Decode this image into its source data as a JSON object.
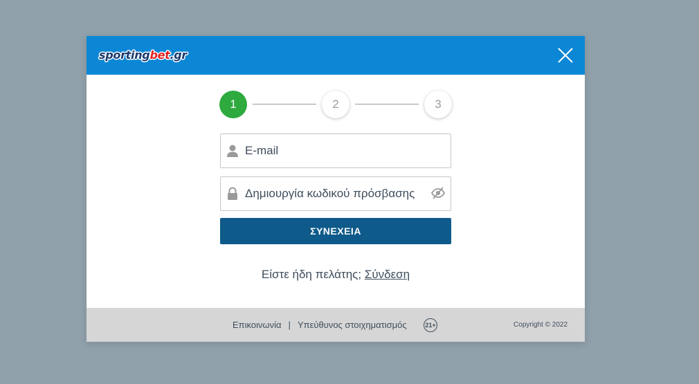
{
  "header": {
    "logo_part1": "sporting",
    "logo_part2": "bet",
    "logo_part3": ".gr",
    "close_icon": "close-icon"
  },
  "steps": [
    {
      "label": "1",
      "active": true
    },
    {
      "label": "2",
      "active": false
    },
    {
      "label": "3",
      "active": false
    }
  ],
  "form": {
    "email_placeholder": "E-mail",
    "email_icon": "user-icon",
    "password_placeholder": "Δημιουργία κωδικού πρόσβασης",
    "password_icon": "lock-icon",
    "toggle_icon": "eye-slash-icon",
    "continue_label": "ΣΥΝΕΧΕΙΑ"
  },
  "login": {
    "question": "Είστε ήδη πελάτης;",
    "link": "Σύνδεση"
  },
  "footer": {
    "contact": "Επικοινωνία",
    "separator": "|",
    "responsible": "Υπεύθυνος στοιχηματισμός",
    "age_badge": "21+",
    "copyright": "Copyright © 2022"
  },
  "colors": {
    "backdrop": "#91a1ac",
    "header": "#0c87d6",
    "step_active": "#2eaa3f",
    "button": "#0e5a8a",
    "footer": "#d6d6d6"
  }
}
